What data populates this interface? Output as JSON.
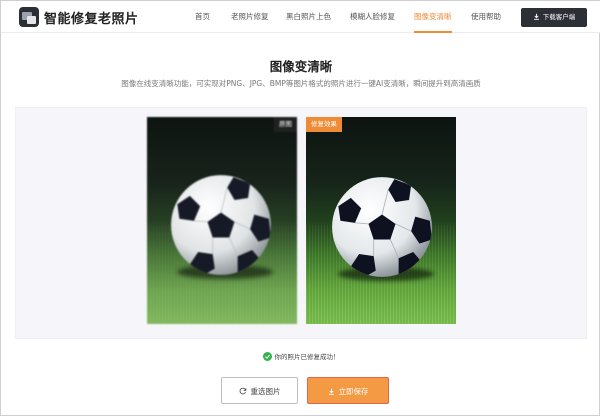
{
  "header": {
    "brand": "智能修复老照片",
    "nav": [
      {
        "label": "首页",
        "active": false
      },
      {
        "label": "老照片修复",
        "active": false
      },
      {
        "label": "黑白照片上色",
        "active": false
      },
      {
        "label": "模糊人脸修复",
        "active": false
      },
      {
        "label": "图像变清晰",
        "active": true
      },
      {
        "label": "使用帮助",
        "active": false
      }
    ],
    "download_label": "下载客户端"
  },
  "main": {
    "title": "图像变清晰",
    "subtitle": "图像在线变清晰功能，可实现对PNG、JPG、BMP等图片格式的照片进行一键AI变清晰，瞬间提升到高清画质"
  },
  "compare": {
    "original_tag": "原图",
    "fixed_tag": "修复效果"
  },
  "status": {
    "success_text": "你的照片已修复成功！"
  },
  "actions": {
    "reselect_label": "重选图片",
    "save_label": "立即保存"
  },
  "colors": {
    "accent": "#ef8a35",
    "dark": "#2d2f36",
    "success": "#2fb54a",
    "save_border": "#e7644b"
  },
  "icons": {
    "logo": "app-logo-icon",
    "download": "download-icon",
    "check": "check-circle-icon",
    "refresh": "refresh-icon",
    "save": "download-icon"
  }
}
